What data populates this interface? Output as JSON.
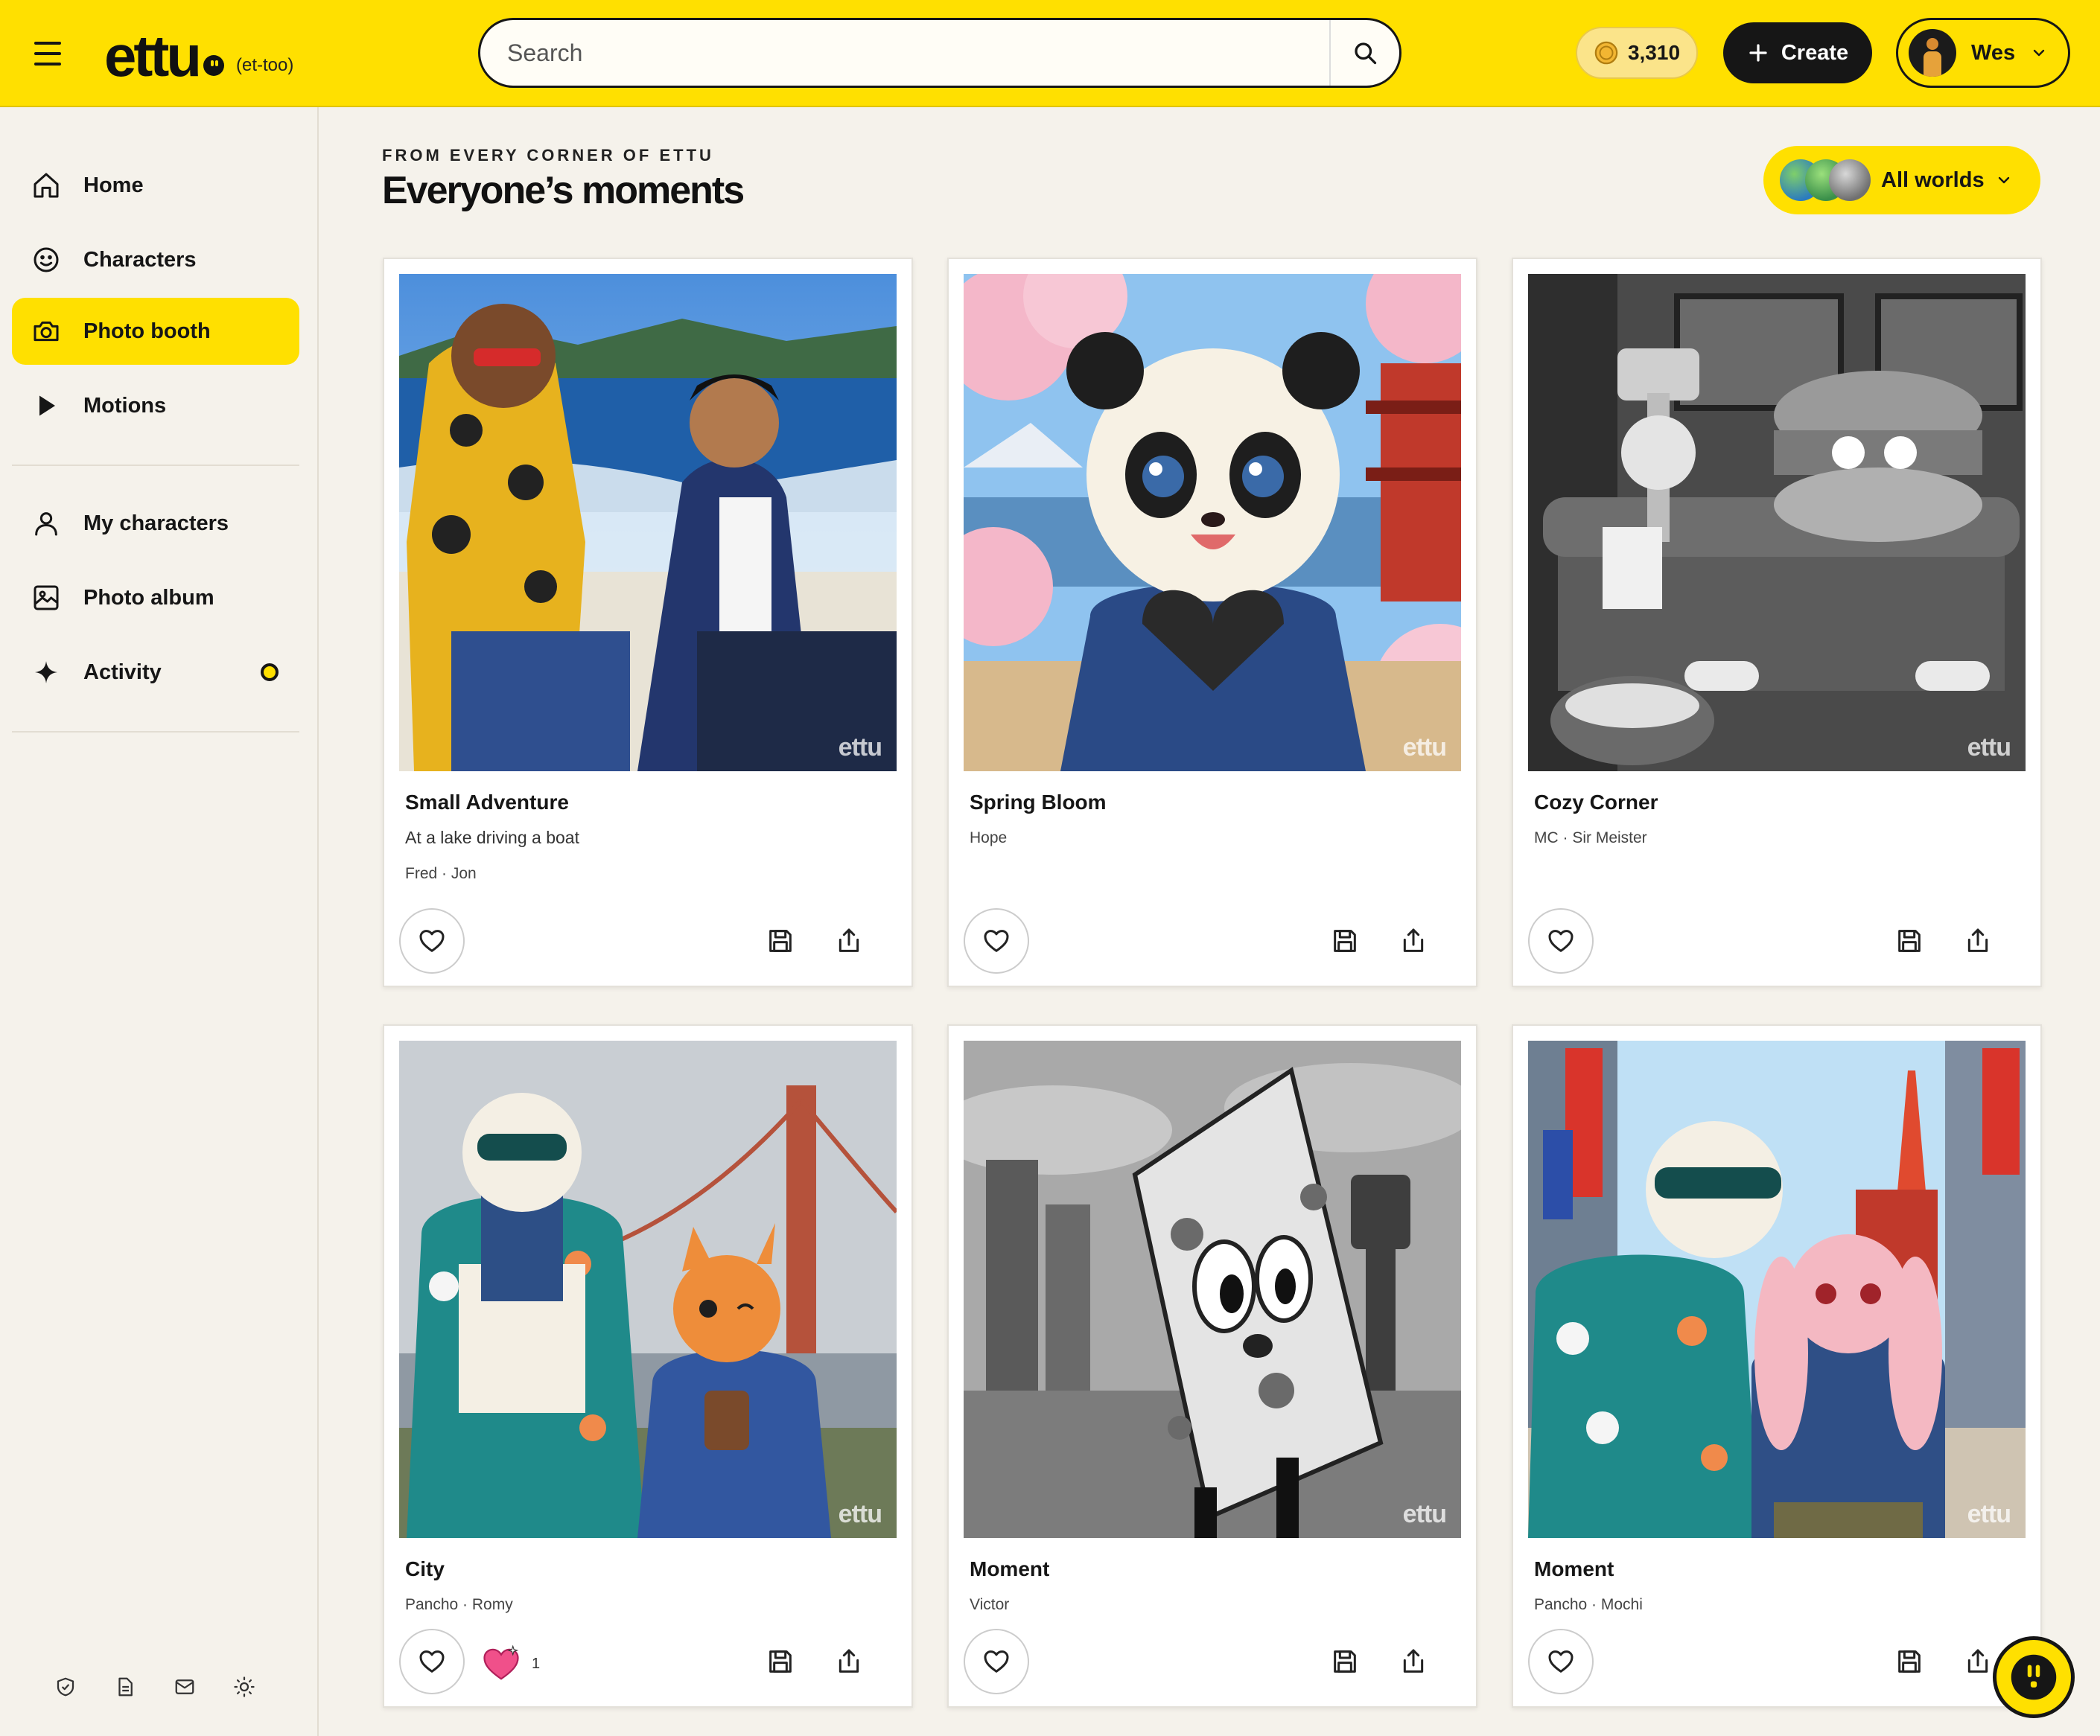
{
  "header": {
    "logo_text": "ettu",
    "logo_pronunciation": "(et-too)",
    "search_placeholder": "Search",
    "coin_balance": "3,310",
    "create_label": "Create",
    "user_name": "Wes"
  },
  "sidebar": {
    "items": [
      {
        "label": "Home",
        "icon": "home-icon"
      },
      {
        "label": "Characters",
        "icon": "smiley-icon"
      },
      {
        "label": "Photo booth",
        "icon": "camera-icon",
        "active": true
      },
      {
        "label": "Motions",
        "icon": "play-icon"
      },
      {
        "label": "My characters",
        "icon": "person-icon"
      },
      {
        "label": "Photo album",
        "icon": "photo-album-icon"
      },
      {
        "label": "Activity",
        "icon": "sparkle-icon",
        "has_notification": true
      }
    ],
    "footer_icons": [
      "shield-check-icon",
      "document-icon",
      "mail-icon",
      "sun-icon"
    ]
  },
  "main": {
    "eyebrow": "FROM EVERY CORNER OF ETTU",
    "title": "Everyone’s moments",
    "worlds_filter": "All worlds",
    "watermark": "ettu",
    "cards": [
      {
        "title": "Small Adventure",
        "description": "At a lake driving a boat",
        "characters": "Fred · Jon"
      },
      {
        "title": "Spring Bloom",
        "description": "",
        "characters": "Hope"
      },
      {
        "title": "Cozy Corner",
        "description": "",
        "characters": "MC · Sir Meister"
      },
      {
        "title": "City",
        "description": "",
        "characters": "Pancho · Romy",
        "reaction_count": "1"
      },
      {
        "title": "Moment",
        "description": "",
        "characters": "Victor"
      },
      {
        "title": "Moment",
        "description": "",
        "characters": "Pancho · Mochi"
      }
    ]
  },
  "colors": {
    "brand_yellow": "#ffe000",
    "ink": "#161616",
    "page_bg": "#f5f2eb"
  }
}
